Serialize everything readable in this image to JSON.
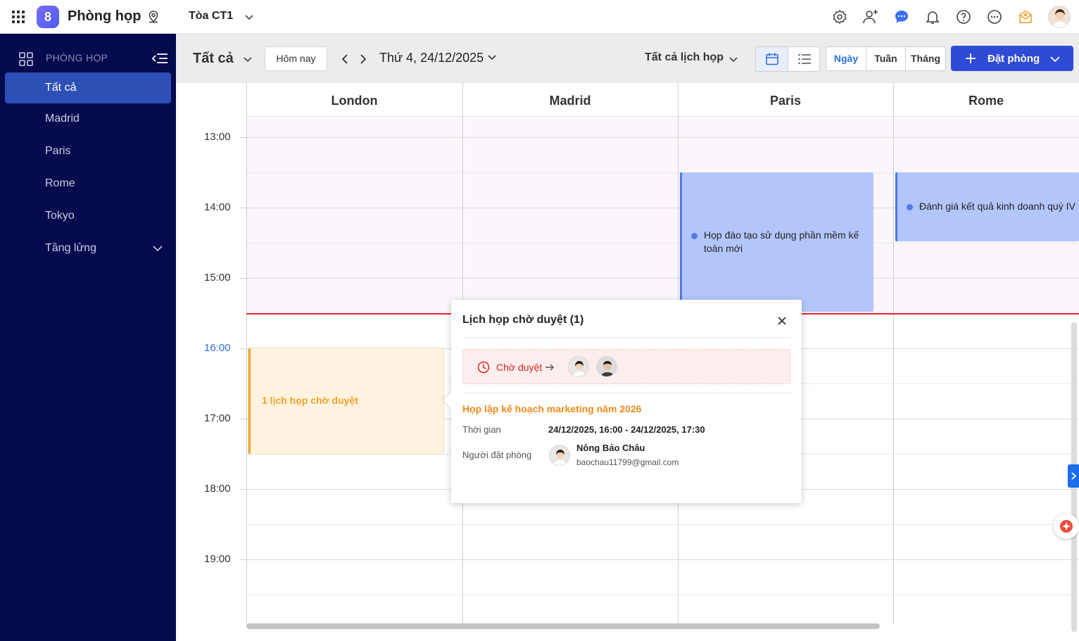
{
  "topbar": {
    "app_title": "Phòng họp",
    "building": "Tòa CT1",
    "icons": [
      "settings-icon",
      "add-user-icon",
      "chat-icon",
      "bell-icon",
      "help-icon",
      "more-icon",
      "gift-icon",
      "avatar"
    ]
  },
  "sidebar": {
    "heading": "PHÒNG HỌP",
    "items": [
      {
        "label": "Tất cả"
      },
      {
        "label": "Madrid"
      },
      {
        "label": "Paris"
      },
      {
        "label": "Rome"
      },
      {
        "label": "Tokyo"
      },
      {
        "label": "Tầng lửng"
      }
    ]
  },
  "toolbar": {
    "filter_label": "Tất cả",
    "today_label": "Hôm nay",
    "date_label": "Thứ 4, 24/12/2025",
    "meeting_filter": "Tất cả lịch họp",
    "modes": [
      "Ngày",
      "Tuần",
      "Tháng"
    ],
    "active_mode": "Ngày",
    "book_label": "Đặt phòng"
  },
  "calendar": {
    "columns": [
      "London",
      "Madrid",
      "Paris",
      "Rome"
    ],
    "times": [
      "13:00",
      "14:00",
      "15:00",
      "16:00",
      "17:00",
      "18:00",
      "19:00"
    ],
    "current_hour": "16:00",
    "events": [
      {
        "room": "Paris",
        "title": "Họp đào tạo sử dụng phần mềm kế toán mới"
      },
      {
        "room": "Rome",
        "title": "Đánh giá kết quả kinh doanh quý IV"
      }
    ],
    "pending_block": "1 lịch họp chờ duyệt"
  },
  "popover": {
    "title": "Lịch họp chờ duyệt (1)",
    "status": "Chờ duyệt",
    "meeting_title": "Họp lập kế hoạch marketing năm 2026",
    "time_label": "Thời gian",
    "time_value": "24/12/2025, 16:00 - 24/12/2025, 17:30",
    "booker_label": "Người đặt phòng",
    "booker_name": "Nông Bảo Châu",
    "booker_email": "baochau11799@gmail.com"
  },
  "colors": {
    "sidebar_bg": "#040a4c",
    "sidebar_active": "#2e4fb6",
    "primary": "#2f4ad6",
    "event_bg": "#b3c6fb",
    "event_accent": "#4f7ae8",
    "pending_bg": "#fff3df",
    "pending_accent": "#f2a12e",
    "now_line": "#e3262a",
    "status_red": "#e02424"
  }
}
